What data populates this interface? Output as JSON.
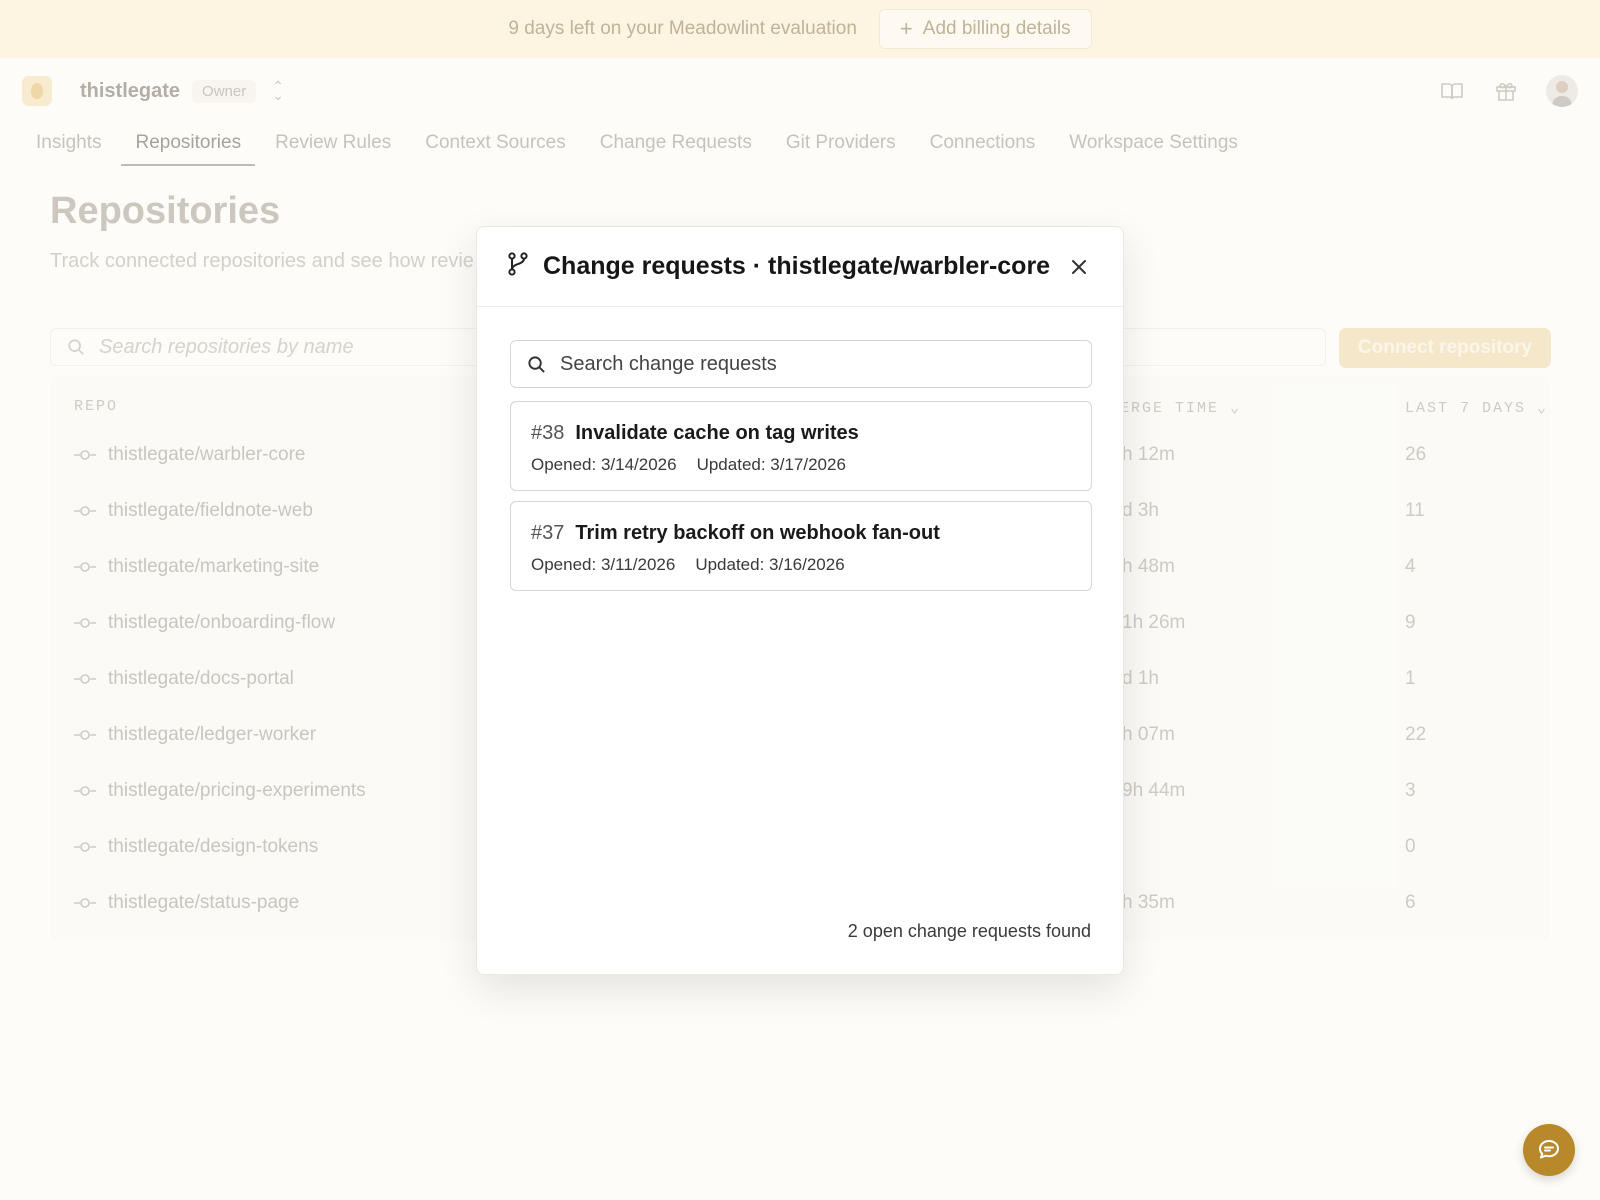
{
  "banner": {
    "text": "9 days left on your Meadowlint evaluation",
    "button_label": "Add billing details"
  },
  "topbar": {
    "org_name": "thistlegate",
    "role": "Owner",
    "icons": [
      "book-icon",
      "gift-icon",
      "avatar"
    ]
  },
  "tabs": [
    {
      "label": "Insights",
      "active": false
    },
    {
      "label": "Repositories",
      "active": true
    },
    {
      "label": "Review Rules",
      "active": false
    },
    {
      "label": "Context Sources",
      "active": false
    },
    {
      "label": "Change Requests",
      "active": false
    },
    {
      "label": "Git Providers",
      "active": false
    },
    {
      "label": "Connections",
      "active": false
    },
    {
      "label": "Workspace Settings",
      "active": false
    }
  ],
  "page": {
    "title": "Repositories",
    "subtitle": "Track connected repositories and see how revie",
    "search_placeholder": "Search repositories by name",
    "connect_label": "Connect repository"
  },
  "table": {
    "headers": {
      "repo": "REPO",
      "merge_time": "ERGE TIME",
      "last7": "LAST 7 DAYS"
    },
    "rows": [
      {
        "repo": "thistlegate/warbler-core",
        "merge_time": "h 12m",
        "last7": "26"
      },
      {
        "repo": "thistlegate/fieldnote-web",
        "merge_time": "d 3h",
        "last7": "11"
      },
      {
        "repo": "thistlegate/marketing-site",
        "merge_time": "h 48m",
        "last7": "4"
      },
      {
        "repo": "thistlegate/onboarding-flow",
        "merge_time": "1h 26m",
        "last7": "9"
      },
      {
        "repo": "thistlegate/docs-portal",
        "merge_time": "d 1h",
        "last7": "1"
      },
      {
        "repo": "thistlegate/ledger-worker",
        "merge_time": "h 07m",
        "last7": "22"
      },
      {
        "repo": "thistlegate/pricing-experiments",
        "merge_time": "9h 44m",
        "last7": "3"
      },
      {
        "repo": "thistlegate/design-tokens",
        "merge_time": "",
        "last7": "0"
      },
      {
        "repo": "thistlegate/status-page",
        "merge_time": "h 35m",
        "last7": "6"
      }
    ]
  },
  "modal": {
    "title": "Change requests · thistlegate/warbler-core",
    "search_placeholder": "Search change requests",
    "items": [
      {
        "number": "#38",
        "title": "Invalidate cache on tag writes",
        "opened": "Opened: 3/14/2026",
        "updated": "Updated: 3/17/2026"
      },
      {
        "number": "#37",
        "title": "Trim retry backoff on webhook fan-out",
        "opened": "Opened: 3/11/2026",
        "updated": "Updated: 3/16/2026"
      }
    ],
    "footer": "2 open change requests found"
  },
  "colors": {
    "banner_bg": "#fdf3de",
    "accent": "#b8892a",
    "page_bg": "#fdfcf8"
  }
}
